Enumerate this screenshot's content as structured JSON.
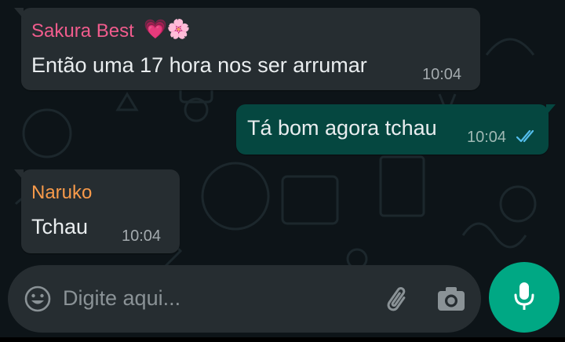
{
  "chat": {
    "messages": [
      {
        "direction": "incoming",
        "sender": "Sakura Best",
        "sender_emoji": "💗🌸",
        "sender_color": "#f15c8d",
        "text": "Então uma 17 hora nos ser arrumar",
        "time": "10:04"
      },
      {
        "direction": "outgoing",
        "text": "Tá bom agora tchau",
        "time": "10:04",
        "status_icon": "double-check-icon",
        "status_color": "#53bdeb"
      },
      {
        "direction": "incoming",
        "sender": "Naruko",
        "sender_color": "#f79a4a",
        "text": "Tchau",
        "time": "10:04"
      }
    ]
  },
  "composer": {
    "placeholder": "Digite aqui...",
    "icons": [
      "emoji-icon",
      "attach-icon",
      "camera-icon"
    ]
  },
  "mic_button": {
    "icon": "microphone-icon",
    "color": "#00a884"
  },
  "colors": {
    "background": "#0d1418",
    "incoming_bubble": "#262d31",
    "outgoing_bubble": "#054740"
  }
}
